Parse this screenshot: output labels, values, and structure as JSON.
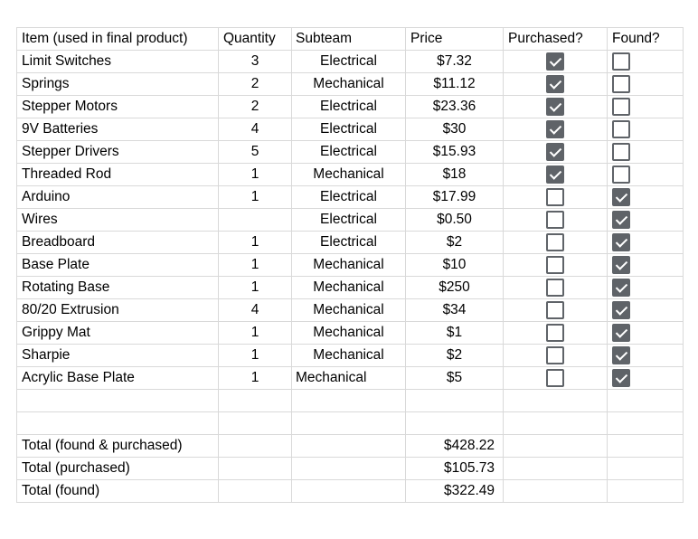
{
  "headers": {
    "item": "Item (used in final product)",
    "quantity": "Quantity",
    "subteam": "Subteam",
    "price": "Price",
    "purchased": "Purchased?",
    "found": "Found?"
  },
  "rows": [
    {
      "item": "Limit Switches",
      "quantity": "3",
      "subteam": "Electrical",
      "price": "$7.32",
      "purchased": true,
      "found": false
    },
    {
      "item": "Springs",
      "quantity": "2",
      "subteam": "Mechanical",
      "price": "$11.12",
      "purchased": true,
      "found": false
    },
    {
      "item": "Stepper Motors",
      "quantity": "2",
      "subteam": "Electrical",
      "price": "$23.36",
      "purchased": true,
      "found": false
    },
    {
      "item": "9V Batteries",
      "quantity": "4",
      "subteam": "Electrical",
      "price": "$30",
      "purchased": true,
      "found": false
    },
    {
      "item": "Stepper Drivers",
      "quantity": "5",
      "subteam": "Electrical",
      "price": "$15.93",
      "purchased": true,
      "found": false
    },
    {
      "item": "Threaded Rod",
      "quantity": "1",
      "subteam": "Mechanical",
      "price": "$18",
      "purchased": true,
      "found": false
    },
    {
      "item": "Arduino",
      "quantity": "1",
      "subteam": "Electrical",
      "price": "$17.99",
      "purchased": false,
      "found": true
    },
    {
      "item": "Wires",
      "quantity": "",
      "subteam": "Electrical",
      "price": "$0.50",
      "purchased": false,
      "found": true
    },
    {
      "item": "Breadboard",
      "quantity": "1",
      "subteam": "Electrical",
      "price": "$2",
      "purchased": false,
      "found": true
    },
    {
      "item": "Base Plate",
      "quantity": "1",
      "subteam": "Mechanical",
      "price": "$10",
      "purchased": false,
      "found": true
    },
    {
      "item": "Rotating Base",
      "quantity": "1",
      "subteam": "Mechanical",
      "price": "$250",
      "purchased": false,
      "found": true
    },
    {
      "item": "80/20 Extrusion",
      "quantity": "4",
      "subteam": "Mechanical",
      "price": "$34",
      "purchased": false,
      "found": true
    },
    {
      "item": "Grippy Mat",
      "quantity": "1",
      "subteam": "Mechanical",
      "price": "$1",
      "purchased": false,
      "found": true
    },
    {
      "item": "Sharpie",
      "quantity": "1",
      "subteam": "Mechanical",
      "price": "$2",
      "purchased": false,
      "found": true
    },
    {
      "item": "Acrylic Base Plate",
      "quantity": "1",
      "subteam": "Mechanical",
      "subteam_left": true,
      "price": "$5",
      "purchased": false,
      "found": true
    }
  ],
  "totals": [
    {
      "label": "Total (found & purchased)",
      "value": "$428.22"
    },
    {
      "label": "Total (purchased)",
      "value": "$105.73"
    },
    {
      "label": "Total (found)",
      "value": "$322.49"
    }
  ]
}
